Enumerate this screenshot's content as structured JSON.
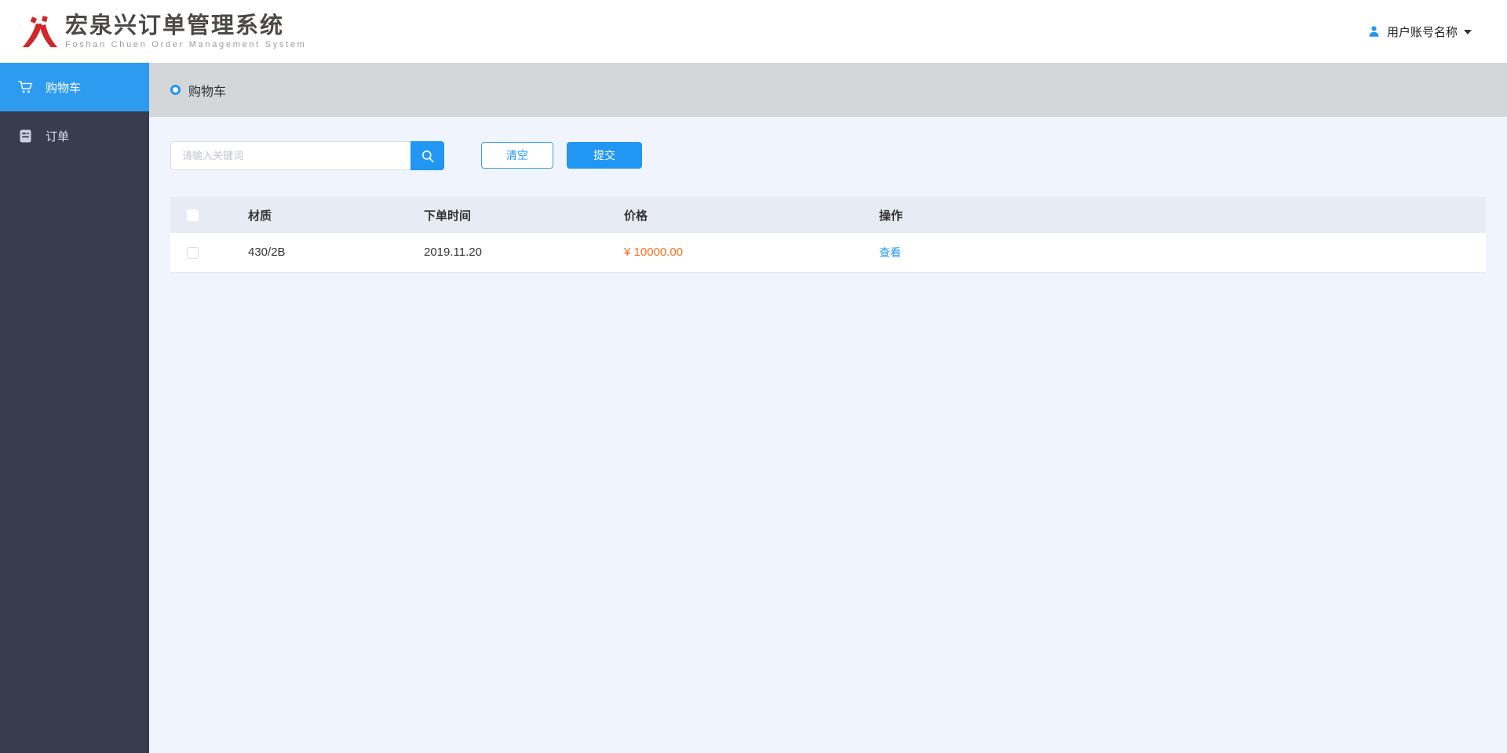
{
  "brand": {
    "title": "宏泉兴订单管理系统",
    "subtitle": "Foshan Chuen Order Management System",
    "logo_icon": "brand-logo-icon",
    "logo_color": "#d0272b"
  },
  "topbar": {
    "user_name": "用户账号名称",
    "user_icon": "user-icon",
    "caret_icon": "caret-down-icon"
  },
  "sidebar": {
    "items": [
      {
        "label": "购物车",
        "icon": "cart-icon",
        "active": true
      },
      {
        "label": "订单",
        "icon": "order-list-icon",
        "active": false
      }
    ]
  },
  "page": {
    "title": "购物车",
    "title_icon": "radio-ring-icon"
  },
  "search": {
    "placeholder": "请输入关键词",
    "value": "",
    "search_icon": "search-icon",
    "clear_label": "清空",
    "submit_label": "提交"
  },
  "table": {
    "columns": [
      "材质",
      "下单时间",
      "价格",
      "操作"
    ],
    "select_all_checked": false,
    "rows": [
      {
        "checked": false,
        "material": "430/2B",
        "order_time": "2019.11.20",
        "price": "¥ 10000.00",
        "action": "查看"
      }
    ]
  },
  "colors": {
    "primary_blue": "#2196f3",
    "sidebar_bg": "#373c4e",
    "sidebar_active": "#2d9bf0",
    "header_band": "#d3d7da",
    "content_bg": "#f0f4fc",
    "table_header_bg": "#e7ebf3",
    "price_orange": "#fa6a1c",
    "brand_red": "#d0272b"
  }
}
